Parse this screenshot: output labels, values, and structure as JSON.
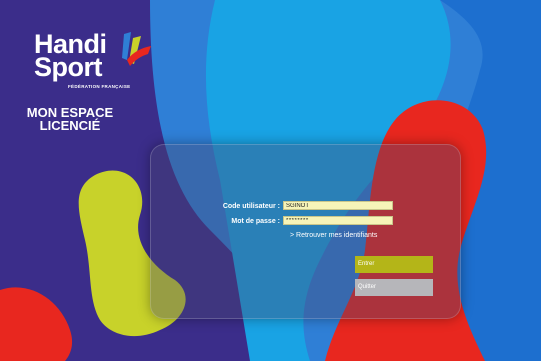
{
  "logo": {
    "line1": "Handi",
    "line2": "Sport",
    "federation": "FÉDÉRATION FRANÇAISE"
  },
  "space_title": {
    "line1": "MON ESPACE",
    "line2": "LICENCIÉ"
  },
  "login": {
    "username_label": "Code utilisateur :",
    "username_value": "SGINOT",
    "password_label": "Mot de passe :",
    "password_value": "********",
    "forgot_link": "> Retrouver mes identifiants",
    "enter_button": "Entrer",
    "quit_button": "Quitter"
  },
  "colors": {
    "navy": "#3b2d8a",
    "blue": "#2f7fd6",
    "cyan": "#19a3e4",
    "red": "#e8271f",
    "lime": "#c8d22a",
    "input_bg": "#f6f4b8"
  }
}
